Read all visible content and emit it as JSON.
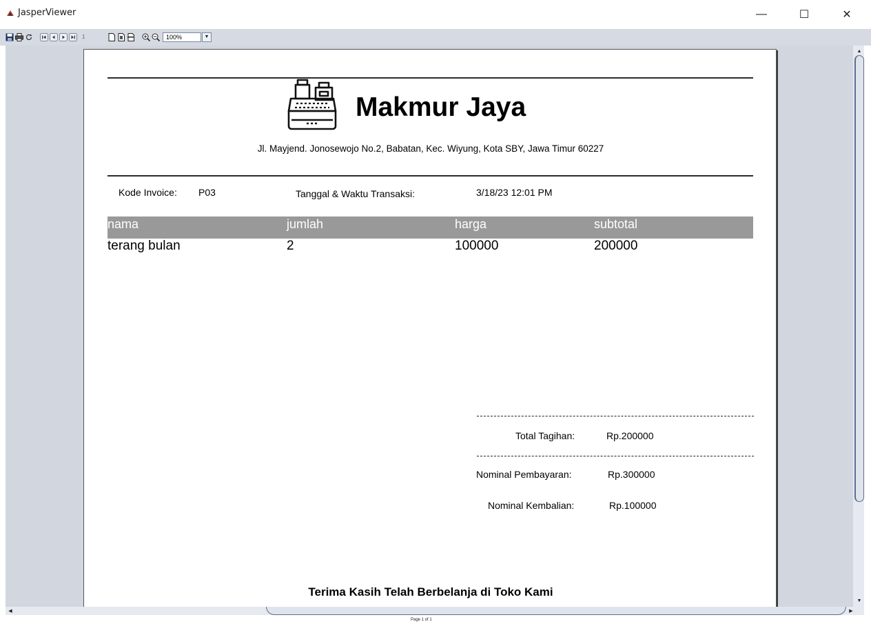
{
  "window": {
    "title": "JasperViewer",
    "controls": {
      "minimize": "—",
      "maximize": "☐",
      "close": "✕"
    }
  },
  "toolbar": {
    "page_number": "1",
    "zoom": "100%",
    "icons": [
      "save-icon",
      "print-icon",
      "reload-icon",
      "first-page-icon",
      "previous-page-icon",
      "next-page-icon",
      "last-page-icon",
      "actual-size-icon",
      "fit-page-icon",
      "fit-width-icon",
      "zoom-in-icon",
      "zoom-out-icon"
    ]
  },
  "report": {
    "store_name": "Makmur Jaya",
    "address": "Jl. Mayjend. Jonosewojo No.2, Babatan, Kec. Wiyung, Kota SBY, Jawa Timur 60227",
    "invoice_label": "Kode Invoice:",
    "invoice_code": "P03",
    "datetime_label": "Tanggal & Waktu Transaksi:",
    "datetime": "3/18/23 12:01 PM",
    "columns": [
      "nama",
      "jumlah",
      "harga",
      "subtotal"
    ],
    "rows": [
      [
        "terang bulan",
        "2",
        "100000",
        "200000"
      ]
    ],
    "total_label": "Total Tagihan:",
    "total_value": "Rp.200000",
    "payment_label": "Nominal Pembayaran:",
    "payment_value": "Rp.300000",
    "change_label": "Nominal Kembalian:",
    "change_value": "Rp.100000",
    "thanks": "Terima Kasih Telah Berbelanja di Toko Kami"
  },
  "status": {
    "page_info": "Page 1 of 1"
  },
  "colors": {
    "toolbar_bg": "#d5dae3",
    "viewer_bg": "#d2d6de",
    "table_header_bg": "#999999",
    "logo_red": "#c0392b"
  }
}
